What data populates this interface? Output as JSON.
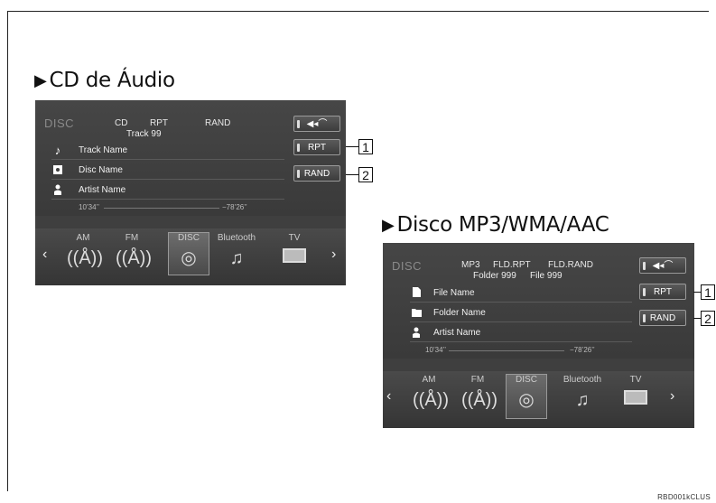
{
  "left": {
    "heading": "CD de Áudio",
    "disc_label": "DISC",
    "modes": [
      "CD",
      "RPT",
      "RAND"
    ],
    "track": "Track 99",
    "rows": [
      {
        "icon": "music-note-icon",
        "label": "Track Name"
      },
      {
        "icon": "disc-icon",
        "label": "Disc Name"
      },
      {
        "icon": "person-icon",
        "label": "Artist Name"
      }
    ],
    "elapsed": "10’34’’",
    "remaining": "−78’26’’",
    "buttons": {
      "rpt": "RPT",
      "rand": "RAND"
    },
    "callouts": [
      "1",
      "2"
    ],
    "sources": [
      "AM",
      "FM",
      "DISC",
      "Bluetooth",
      "TV"
    ]
  },
  "right": {
    "heading": "Disco MP3/WMA/AAC",
    "disc_label": "DISC",
    "modes": [
      "MP3",
      "FLD.RPT",
      "FLD.RAND"
    ],
    "folder": "Folder 999",
    "file": "File 999",
    "rows": [
      {
        "icon": "file-icon",
        "label": "File Name"
      },
      {
        "icon": "folder-icon",
        "label": "Folder Name"
      },
      {
        "icon": "person-icon",
        "label": "Artist Name"
      }
    ],
    "elapsed": "10’34’’",
    "remaining": "−78’26’’",
    "buttons": {
      "rpt": "RPT",
      "rand": "RAND"
    },
    "callouts": [
      "1",
      "2"
    ],
    "sources": [
      "AM",
      "FM",
      "DISC",
      "Bluetooth",
      "TV"
    ]
  },
  "arrows": {
    "prev": "‹",
    "next": "›"
  },
  "image_code": "RBD001kCLUS"
}
